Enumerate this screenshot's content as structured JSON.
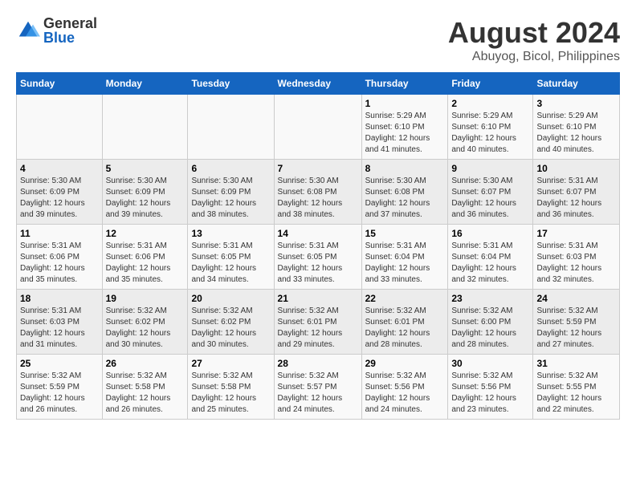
{
  "logo": {
    "general": "General",
    "blue": "Blue"
  },
  "title": {
    "month_year": "August 2024",
    "location": "Abuyog, Bicol, Philippines"
  },
  "headers": [
    "Sunday",
    "Monday",
    "Tuesday",
    "Wednesday",
    "Thursday",
    "Friday",
    "Saturday"
  ],
  "weeks": [
    [
      {
        "day": "",
        "info": ""
      },
      {
        "day": "",
        "info": ""
      },
      {
        "day": "",
        "info": ""
      },
      {
        "day": "",
        "info": ""
      },
      {
        "day": "1",
        "info": "Sunrise: 5:29 AM\nSunset: 6:10 PM\nDaylight: 12 hours and 41 minutes."
      },
      {
        "day": "2",
        "info": "Sunrise: 5:29 AM\nSunset: 6:10 PM\nDaylight: 12 hours and 40 minutes."
      },
      {
        "day": "3",
        "info": "Sunrise: 5:29 AM\nSunset: 6:10 PM\nDaylight: 12 hours and 40 minutes."
      }
    ],
    [
      {
        "day": "4",
        "info": "Sunrise: 5:30 AM\nSunset: 6:09 PM\nDaylight: 12 hours and 39 minutes."
      },
      {
        "day": "5",
        "info": "Sunrise: 5:30 AM\nSunset: 6:09 PM\nDaylight: 12 hours and 39 minutes."
      },
      {
        "day": "6",
        "info": "Sunrise: 5:30 AM\nSunset: 6:09 PM\nDaylight: 12 hours and 38 minutes."
      },
      {
        "day": "7",
        "info": "Sunrise: 5:30 AM\nSunset: 6:08 PM\nDaylight: 12 hours and 38 minutes."
      },
      {
        "day": "8",
        "info": "Sunrise: 5:30 AM\nSunset: 6:08 PM\nDaylight: 12 hours and 37 minutes."
      },
      {
        "day": "9",
        "info": "Sunrise: 5:30 AM\nSunset: 6:07 PM\nDaylight: 12 hours and 36 minutes."
      },
      {
        "day": "10",
        "info": "Sunrise: 5:31 AM\nSunset: 6:07 PM\nDaylight: 12 hours and 36 minutes."
      }
    ],
    [
      {
        "day": "11",
        "info": "Sunrise: 5:31 AM\nSunset: 6:06 PM\nDaylight: 12 hours and 35 minutes."
      },
      {
        "day": "12",
        "info": "Sunrise: 5:31 AM\nSunset: 6:06 PM\nDaylight: 12 hours and 35 minutes."
      },
      {
        "day": "13",
        "info": "Sunrise: 5:31 AM\nSunset: 6:05 PM\nDaylight: 12 hours and 34 minutes."
      },
      {
        "day": "14",
        "info": "Sunrise: 5:31 AM\nSunset: 6:05 PM\nDaylight: 12 hours and 33 minutes."
      },
      {
        "day": "15",
        "info": "Sunrise: 5:31 AM\nSunset: 6:04 PM\nDaylight: 12 hours and 33 minutes."
      },
      {
        "day": "16",
        "info": "Sunrise: 5:31 AM\nSunset: 6:04 PM\nDaylight: 12 hours and 32 minutes."
      },
      {
        "day": "17",
        "info": "Sunrise: 5:31 AM\nSunset: 6:03 PM\nDaylight: 12 hours and 32 minutes."
      }
    ],
    [
      {
        "day": "18",
        "info": "Sunrise: 5:31 AM\nSunset: 6:03 PM\nDaylight: 12 hours and 31 minutes."
      },
      {
        "day": "19",
        "info": "Sunrise: 5:32 AM\nSunset: 6:02 PM\nDaylight: 12 hours and 30 minutes."
      },
      {
        "day": "20",
        "info": "Sunrise: 5:32 AM\nSunset: 6:02 PM\nDaylight: 12 hours and 30 minutes."
      },
      {
        "day": "21",
        "info": "Sunrise: 5:32 AM\nSunset: 6:01 PM\nDaylight: 12 hours and 29 minutes."
      },
      {
        "day": "22",
        "info": "Sunrise: 5:32 AM\nSunset: 6:01 PM\nDaylight: 12 hours and 28 minutes."
      },
      {
        "day": "23",
        "info": "Sunrise: 5:32 AM\nSunset: 6:00 PM\nDaylight: 12 hours and 28 minutes."
      },
      {
        "day": "24",
        "info": "Sunrise: 5:32 AM\nSunset: 5:59 PM\nDaylight: 12 hours and 27 minutes."
      }
    ],
    [
      {
        "day": "25",
        "info": "Sunrise: 5:32 AM\nSunset: 5:59 PM\nDaylight: 12 hours and 26 minutes."
      },
      {
        "day": "26",
        "info": "Sunrise: 5:32 AM\nSunset: 5:58 PM\nDaylight: 12 hours and 26 minutes."
      },
      {
        "day": "27",
        "info": "Sunrise: 5:32 AM\nSunset: 5:58 PM\nDaylight: 12 hours and 25 minutes."
      },
      {
        "day": "28",
        "info": "Sunrise: 5:32 AM\nSunset: 5:57 PM\nDaylight: 12 hours and 24 minutes."
      },
      {
        "day": "29",
        "info": "Sunrise: 5:32 AM\nSunset: 5:56 PM\nDaylight: 12 hours and 24 minutes."
      },
      {
        "day": "30",
        "info": "Sunrise: 5:32 AM\nSunset: 5:56 PM\nDaylight: 12 hours and 23 minutes."
      },
      {
        "day": "31",
        "info": "Sunrise: 5:32 AM\nSunset: 5:55 PM\nDaylight: 12 hours and 22 minutes."
      }
    ]
  ]
}
